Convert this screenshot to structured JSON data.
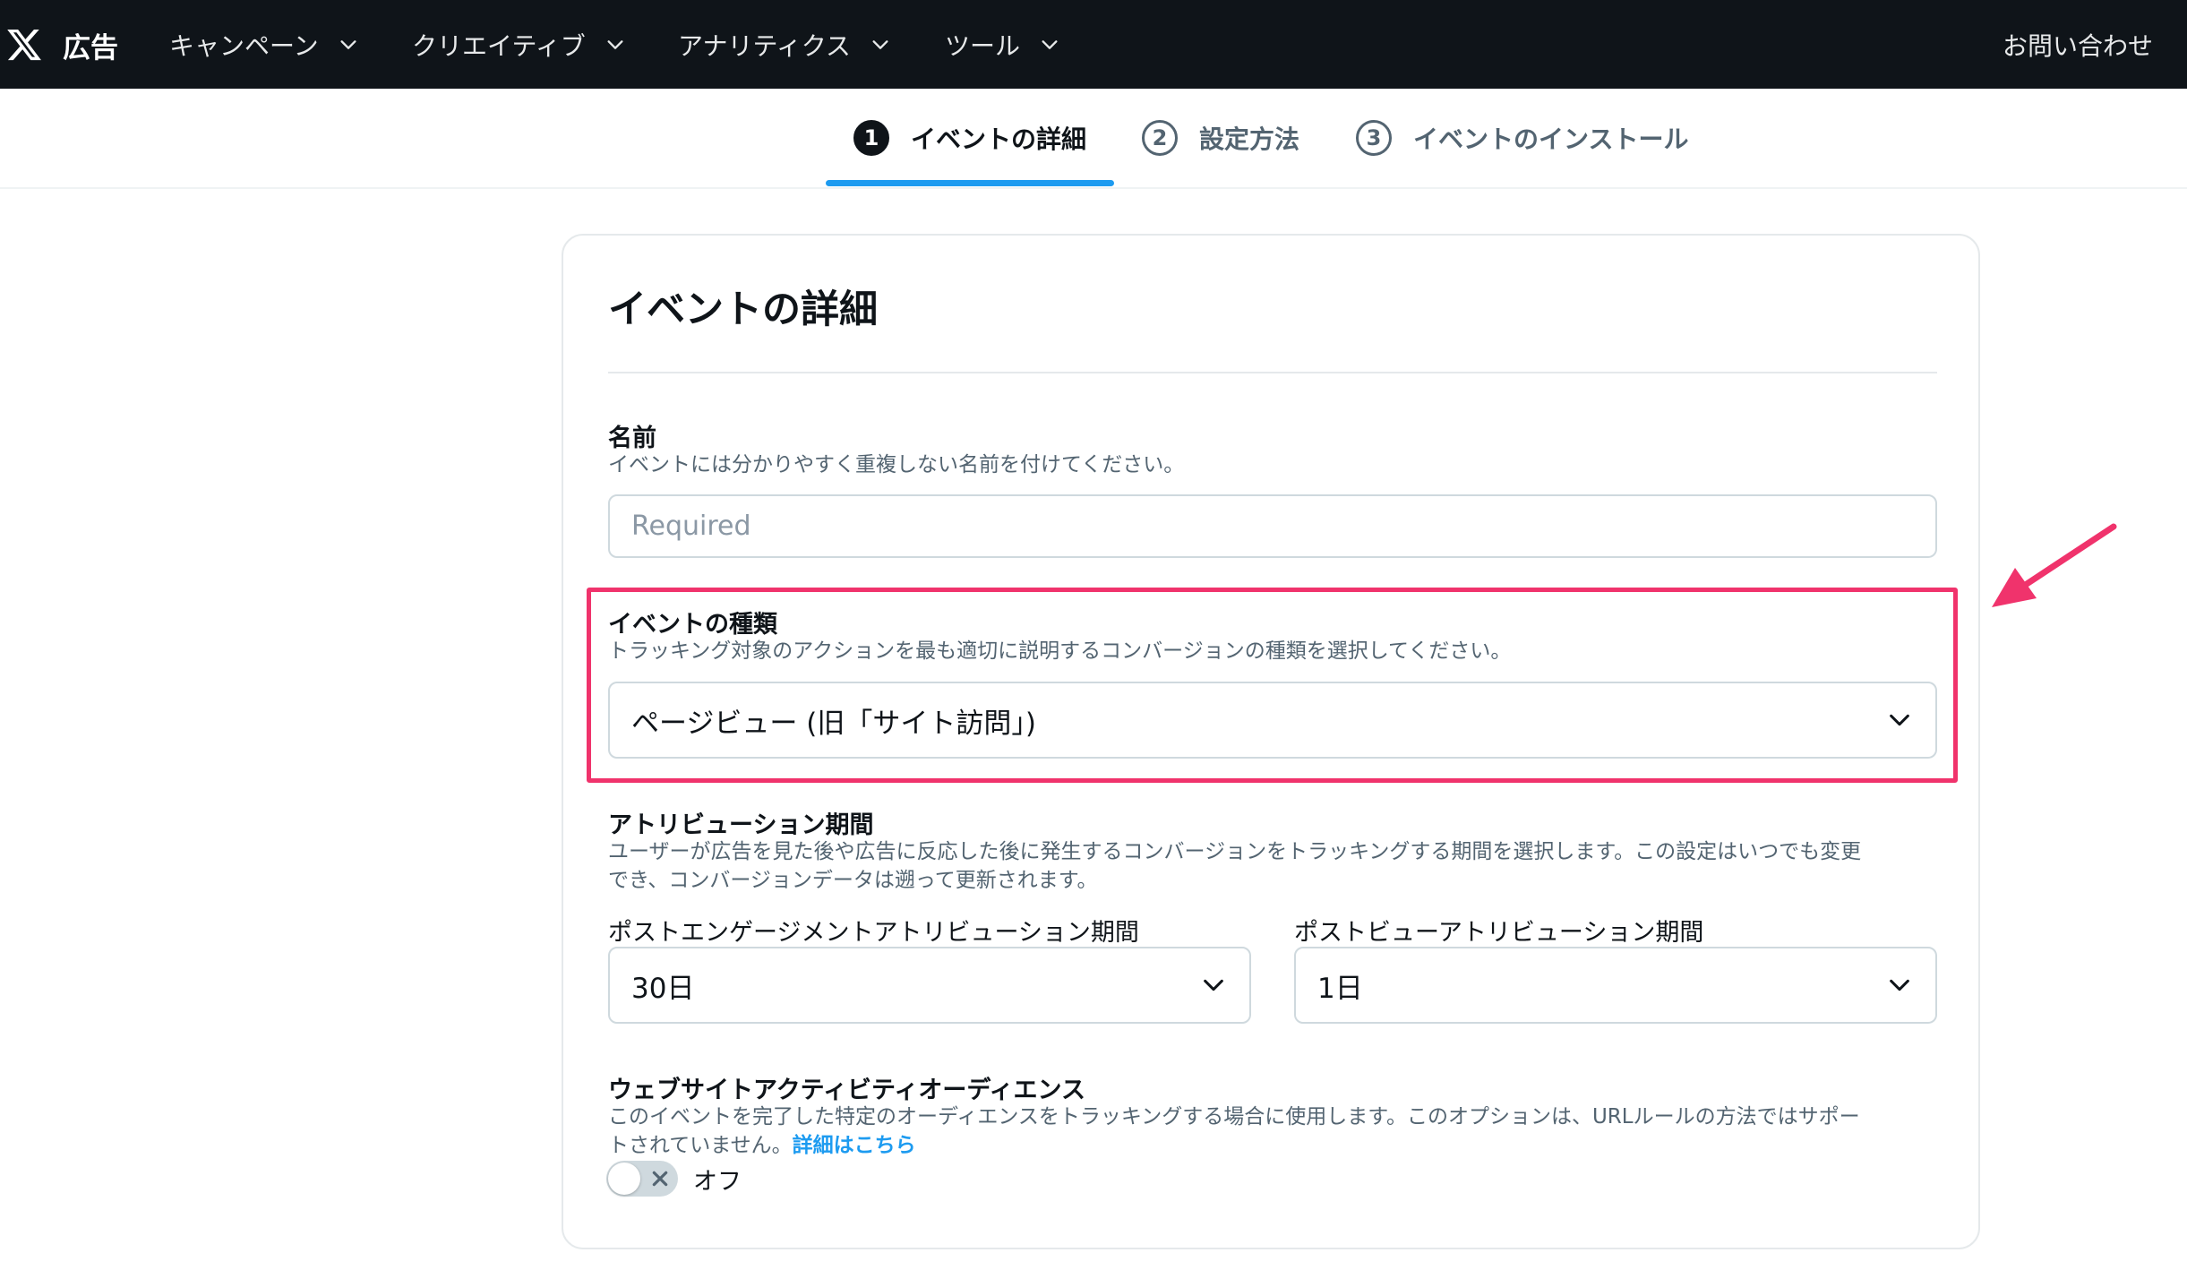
{
  "header": {
    "brand": "広告",
    "nav": [
      {
        "label": "キャンペーン"
      },
      {
        "label": "クリエイティブ"
      },
      {
        "label": "アナリティクス"
      },
      {
        "label": "ツール"
      }
    ],
    "contact": "お問い合わせ"
  },
  "stepper": {
    "steps": [
      {
        "number": "1",
        "label": "イベントの詳細",
        "active": true
      },
      {
        "number": "2",
        "label": "設定方法",
        "active": false
      },
      {
        "number": "3",
        "label": "イベントのインストール",
        "active": false
      }
    ]
  },
  "card": {
    "title": "イベントの詳細",
    "name_field": {
      "label": "名前",
      "description": "イベントには分かりやすく重複しない名前を付けてください。",
      "placeholder": "Required",
      "value": ""
    },
    "event_type": {
      "label": "イベントの種類",
      "description": "トラッキング対象のアクションを最も適切に説明するコンバージョンの種類を選択してください。",
      "selected": "ページビュー (旧「サイト訪問」)"
    },
    "attribution": {
      "label": "アトリビューション期間",
      "description_line1": "ユーザーが広告を見た後や広告に反応した後に発生するコンバージョンをトラッキングする期間を選択します。この設定はいつでも変更",
      "description_line2": "でき、コンバージョンデータは遡って更新されます。",
      "engagement": {
        "label": "ポストエンゲージメントアトリビューション期間",
        "selected": "30日"
      },
      "view": {
        "label": "ポストビューアトリビューション期間",
        "selected": "1日"
      }
    },
    "audience": {
      "label": "ウェブサイトアクティビティオーディエンス",
      "description_line1": "このイベントを完了した特定のオーディエンスをトラッキングする場合に使用します。このオプションは、URLルールの方法ではサポー",
      "description_line2": "トされていません。",
      "link": "詳細はこちら",
      "toggle_label": "オフ",
      "toggle_on": false
    }
  },
  "colors": {
    "topbar": "#0f1419",
    "accent": "#1d9bf0",
    "highlight": "#f0336c"
  }
}
